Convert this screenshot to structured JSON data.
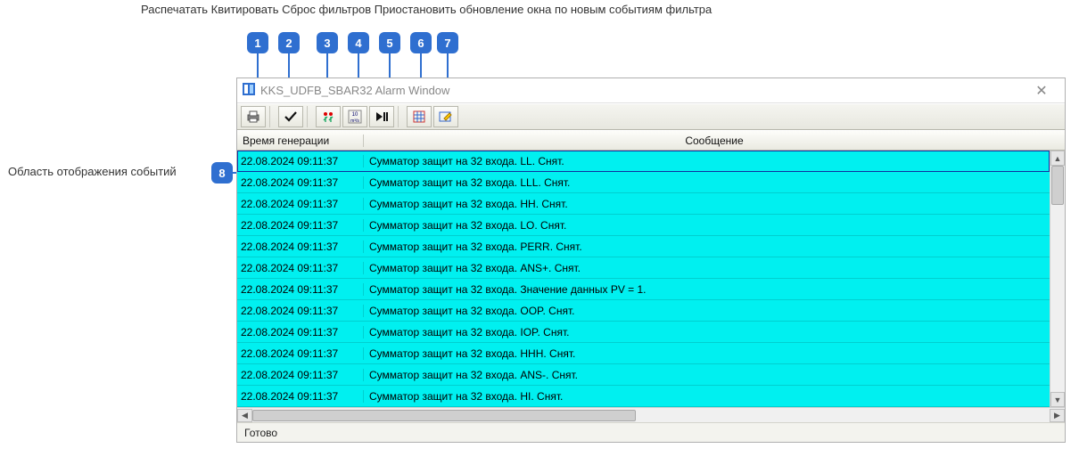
{
  "top_caption": "Распечатать Квитировать Сброс фильтров Приостановить обновление окна по новым событиям фильтра",
  "side_caption": "Область отображения событий",
  "badges": [
    "1",
    "2",
    "3",
    "4",
    "5",
    "6",
    "7"
  ],
  "side_badge": "8",
  "window": {
    "title": "KKS_UDFB_SBAR32 Alarm Window",
    "status": "Готово"
  },
  "columns": {
    "time": "Время генерации",
    "msg": "Сообщение"
  },
  "rows": [
    {
      "time": "22.08.2024 09:11:37",
      "msg": "Сумматор защит на 32 входа. LL. Снят.",
      "selected": true
    },
    {
      "time": "22.08.2024 09:11:37",
      "msg": "Сумматор защит на 32 входа. LLL. Снят."
    },
    {
      "time": "22.08.2024 09:11:37",
      "msg": "Сумматор защит на 32 входа. HH. Снят."
    },
    {
      "time": "22.08.2024 09:11:37",
      "msg": "Сумматор защит на 32 входа. LO. Снят."
    },
    {
      "time": "22.08.2024 09:11:37",
      "msg": "Сумматор защит на 32 входа. PERR. Снят."
    },
    {
      "time": "22.08.2024 09:11:37",
      "msg": "Сумматор защит на 32 входа. ANS+. Снят."
    },
    {
      "time": "22.08.2024 09:11:37",
      "msg": "Сумматор защит на 32 входа. Значение данных PV = 1."
    },
    {
      "time": "22.08.2024 09:11:37",
      "msg": "Сумматор защит на 32 входа. OOP. Снят."
    },
    {
      "time": "22.08.2024 09:11:37",
      "msg": "Сумматор защит на 32 входа. IOP. Снят."
    },
    {
      "time": "22.08.2024 09:11:37",
      "msg": "Сумматор защит на 32 входа. HHH. Снят."
    },
    {
      "time": "22.08.2024 09:11:37",
      "msg": "Сумматор защит на 32 входа. ANS-. Снят."
    },
    {
      "time": "22.08.2024 09:11:37",
      "msg": "Сумматор защит на 32 входа. HI. Снят."
    }
  ]
}
